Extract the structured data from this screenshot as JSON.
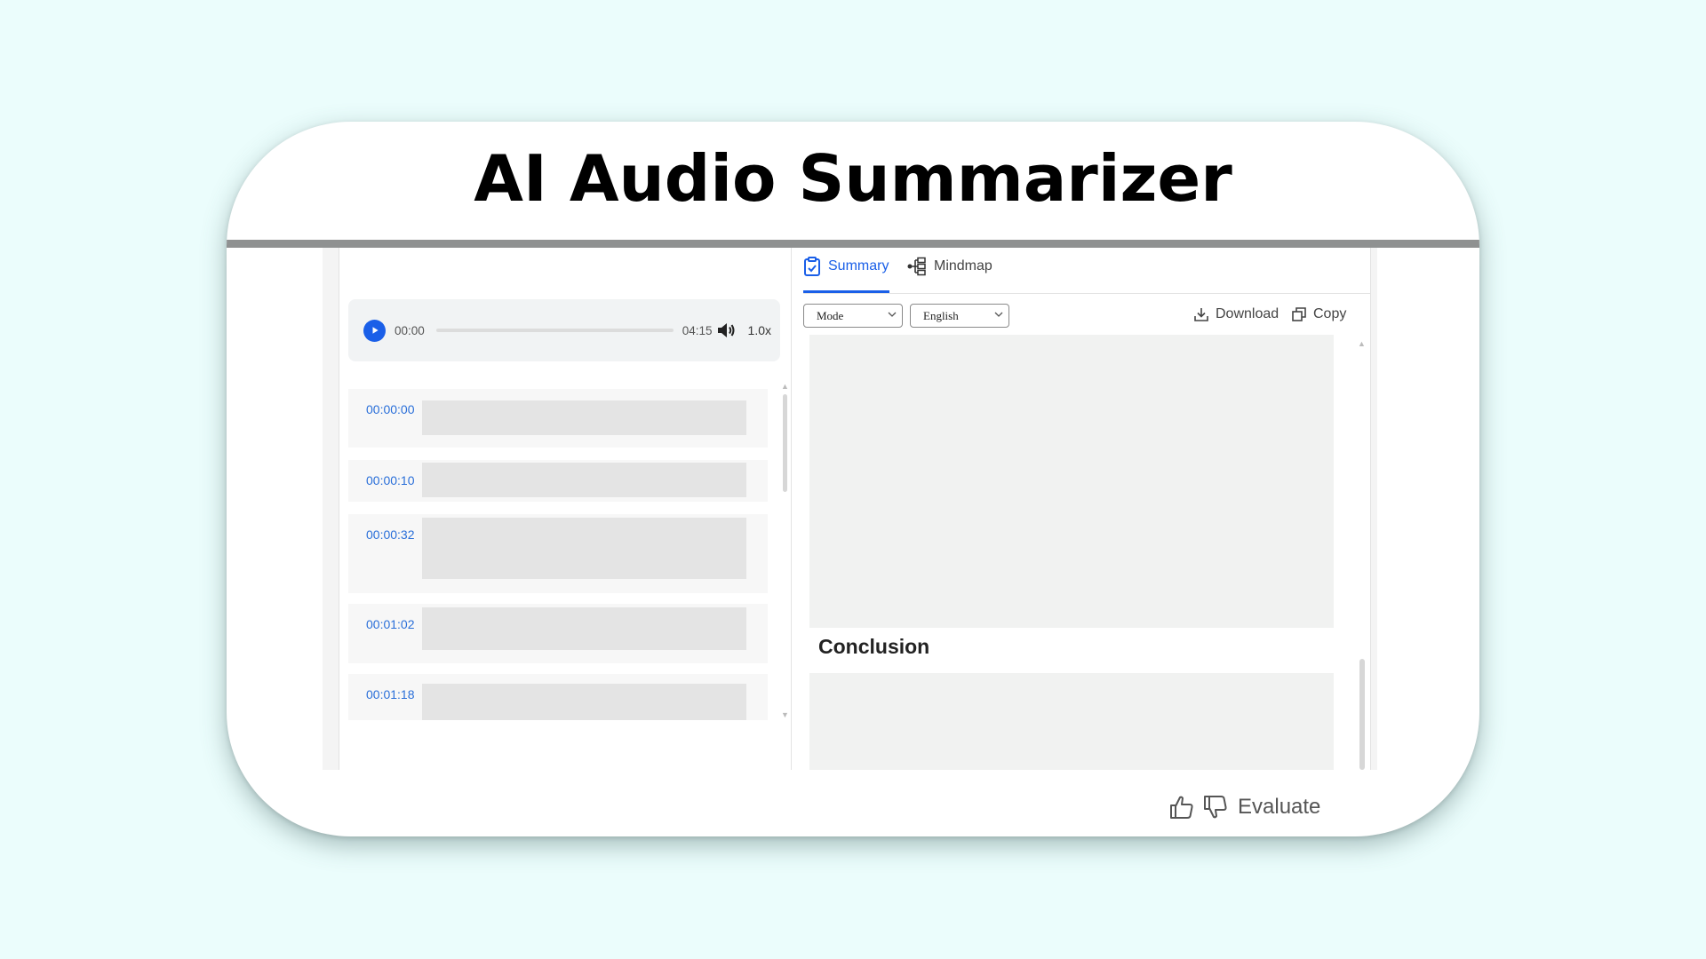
{
  "title": "AI Audio Summarizer",
  "player": {
    "current_time": "00:00",
    "total_time": "04:15",
    "speed": "1.0x",
    "progress": 0
  },
  "transcript": [
    {
      "time": "00:00:00"
    },
    {
      "time": "00:00:10"
    },
    {
      "time": "00:00:32"
    },
    {
      "time": "00:01:02"
    },
    {
      "time": "00:01:18"
    }
  ],
  "tabs": [
    {
      "label": "Summary",
      "icon": "clipboard-check-icon",
      "active": true
    },
    {
      "label": "Mindmap",
      "icon": "mindmap-icon",
      "active": false
    }
  ],
  "selects": {
    "mode": "Mode",
    "language": "English"
  },
  "actions": {
    "download": "Download",
    "copy": "Copy"
  },
  "summary": {
    "conclusion_heading": "Conclusion"
  },
  "evaluate": {
    "label": "Evaluate"
  },
  "colors": {
    "accent": "#1a5fe8",
    "background": "#ebfdfc",
    "timestamp": "#2a6fd9"
  }
}
